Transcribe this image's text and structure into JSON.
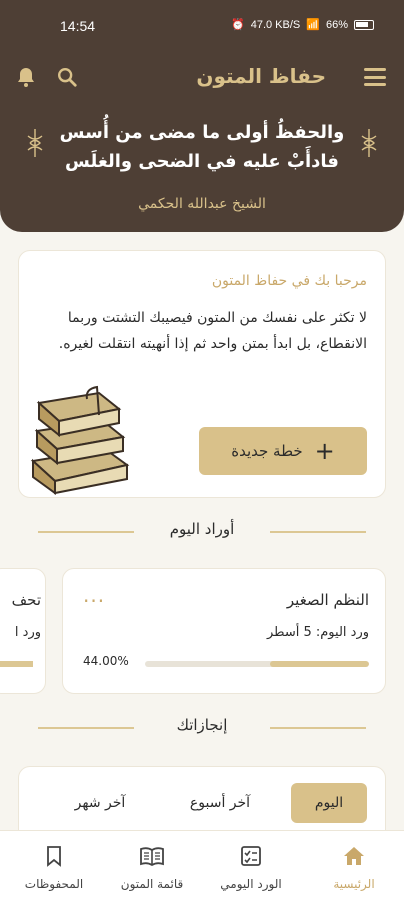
{
  "status": {
    "time": "14:54",
    "net": "47.0 KB/S",
    "battery": "66%"
  },
  "app": {
    "title": "حفاظ المتون"
  },
  "quote": {
    "line1": "والحفظُ أولى ما مضى من أُسس",
    "line2": "فادأَبْ عليه في الضحى والغلَس",
    "author": "الشيخ عبدالله الحكمي"
  },
  "welcome": {
    "title": "مرحبا بك في حفاظ المتون",
    "text": "لا تكثر على نفسك من المتون فيصيبك التشتت وربما الانقطاع، بل ابدأ بمتن واحد ثم إذا أنهيته انتقلت لغيره.",
    "button_label": "خطة جديدة"
  },
  "sections": {
    "daily_wird": "أوراد اليوم",
    "achievements": "إنجازاتك"
  },
  "wird": {
    "title": "النظم الصغير",
    "subtitle": "ورد اليوم: 5 أسطر",
    "progress_label": "44.00%",
    "progress": 0.44,
    "more": "···"
  },
  "wird_next": {
    "title": "تحف",
    "subtitle": "ورد ا"
  },
  "achievements": {
    "today": "اليوم",
    "week": "آخر أسبوع",
    "month": "آخر شهر"
  },
  "nav": {
    "home": "الرئيسية",
    "daily": "الورد اليومي",
    "list": "قائمة المتون",
    "saved": "المحفوظات"
  },
  "colors": {
    "header": "#4e3f35",
    "accent": "#d9c18a",
    "accent_text": "#c9a86a",
    "background": "#f7f5ef"
  },
  "icons": [
    "menu-icon",
    "search-icon",
    "bell-icon",
    "plus-icon",
    "more-icon",
    "home-icon",
    "checklist-icon",
    "open-book-icon",
    "bookmark-icon",
    "books-illustration"
  ]
}
